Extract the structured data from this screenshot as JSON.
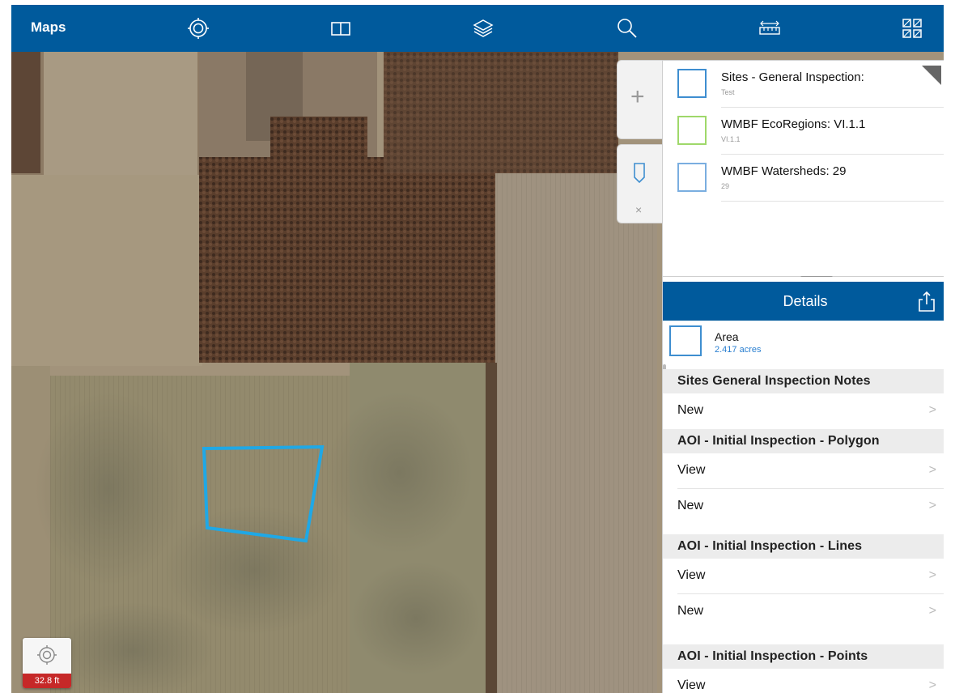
{
  "toolbar": {
    "title": "Maps",
    "icons": [
      "locate-icon",
      "map-book-icon",
      "layers-icon",
      "search-icon",
      "measure-icon",
      "qr-code-icon"
    ],
    "bg_color": "#005a9c"
  },
  "map": {
    "scale_label": "32.8 ft",
    "selection_color": "#1fa8e6"
  },
  "layers": {
    "items": [
      {
        "name": "Sites - General Inspection:",
        "sub": "Test",
        "color": "#3e8ed0"
      },
      {
        "name": "WMBF EcoRegions: VI.1.1",
        "sub": "VI.1.1",
        "color": "#9fd86a"
      },
      {
        "name": "WMBF Watersheds: 29",
        "sub": "29",
        "color": "#7aaee0"
      }
    ]
  },
  "side_tabs": {
    "add_glyph": "+",
    "close_glyph": "×"
  },
  "details": {
    "title": "Details",
    "area_label": "Area",
    "area_value": "2.417 acres",
    "sections": [
      {
        "title": "Sites General Inspection Notes",
        "rows": [
          "New"
        ]
      },
      {
        "title": "AOI - Initial Inspection - Polygon",
        "rows": [
          "View",
          "New"
        ]
      },
      {
        "title": "AOI - Initial Inspection - Lines",
        "rows": [
          "View",
          "New"
        ]
      },
      {
        "title": "AOI - Initial Inspection - Points",
        "rows": [
          "View"
        ]
      }
    ],
    "chevron": ">"
  }
}
